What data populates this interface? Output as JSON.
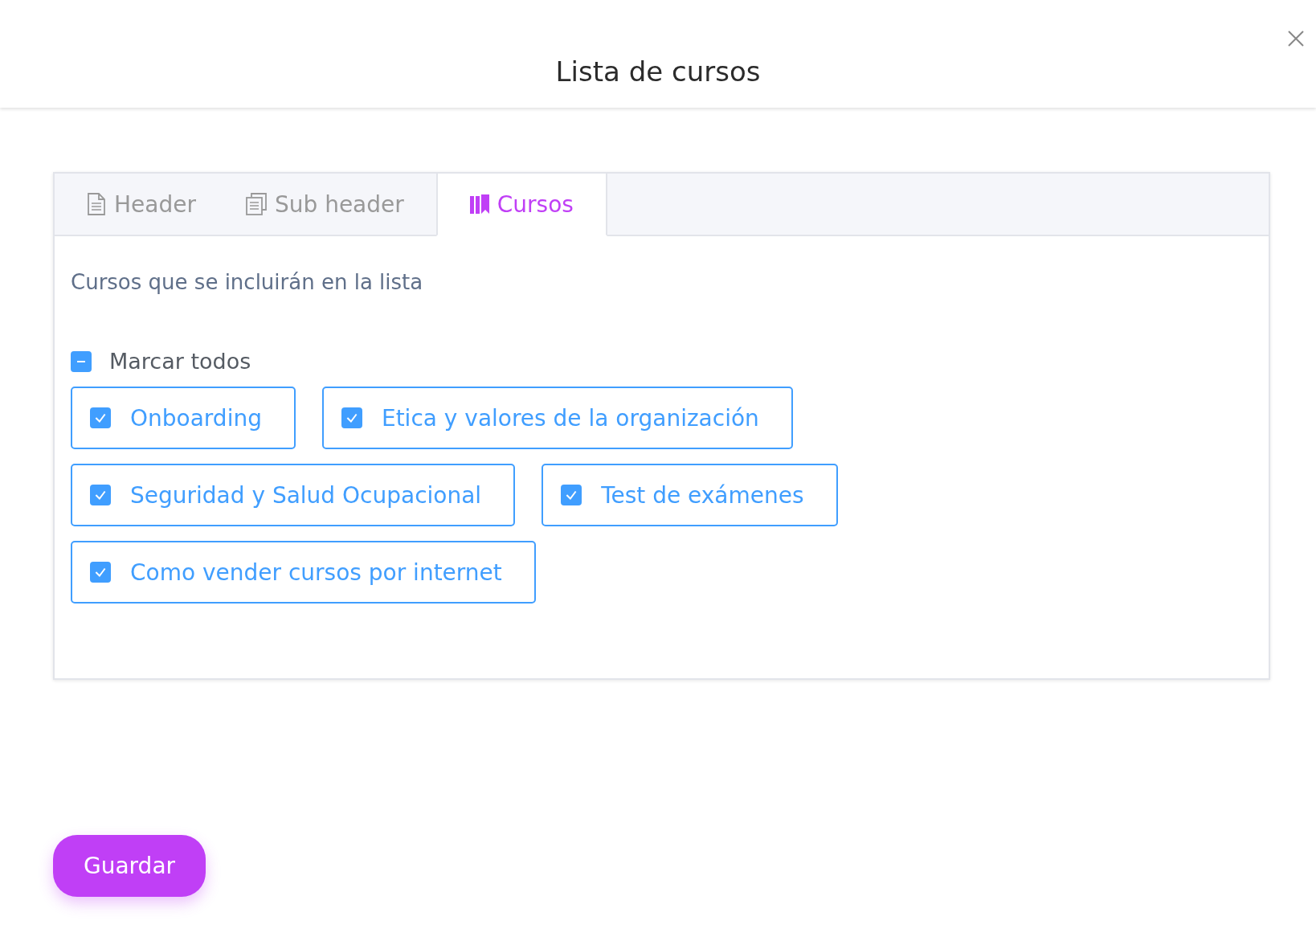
{
  "dialog": {
    "title": "Lista de cursos"
  },
  "tabs": [
    {
      "label": "Header",
      "selected": false
    },
    {
      "label": "Sub header",
      "selected": false
    },
    {
      "label": "Cursos",
      "selected": true
    }
  ],
  "section": {
    "heading": "Cursos que se incluirán en la lista",
    "select_all": {
      "label": "Marcar todos",
      "indeterminate": true
    },
    "courses": [
      {
        "label": "Onboarding",
        "checked": true
      },
      {
        "label": "Etica y valores de la organización",
        "checked": true
      },
      {
        "label": "Seguridad y Salud Ocupacional",
        "checked": true
      },
      {
        "label": "Test de exámenes",
        "checked": true
      },
      {
        "label": "Como vender cursos por internet",
        "checked": true
      }
    ]
  },
  "buttons": [
    {
      "label": "Guardar"
    }
  ]
}
